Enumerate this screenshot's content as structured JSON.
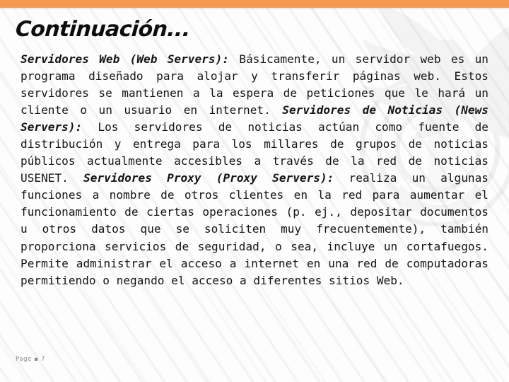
{
  "slide": {
    "title": "Continuación...",
    "footer": "Page ▪ 7",
    "accent_color": "#f59a52",
    "background_color": "#fdfdfd",
    "text_color": "#141414",
    "footer_color": "#8a8a8a"
  },
  "content": {
    "sections": [
      {
        "lead": "Servidores Web (Web Servers):",
        "text": " Básicamente, un servidor web es un programa diseñado para alojar y transferir páginas web. Estos servidores se mantienen a la espera de peticiones que le hará un cliente o un usuario en internet."
      },
      {
        "lead": "Servidores de Noticias (News Servers):",
        "text": " Los servidores de noticias actúan como fuente de distribución y entrega para los millares de grupos de noticias públicos actualmente accesibles a través de la red de noticias USENET."
      },
      {
        "lead": "Servidores Proxy (Proxy Servers):",
        "text": " realiza un algunas funciones a nombre de otros clientes en la red para aumentar el funcionamiento de ciertas operaciones (p. ej., depositar documentos u otros datos que se soliciten muy frecuentemente), también proporciona servicios de seguridad, o sea, incluye un cortafuegos. Permite administrar el acceso a internet en una red de computadoras permitiendo o negando el acceso a diferentes sitios Web."
      }
    ]
  }
}
